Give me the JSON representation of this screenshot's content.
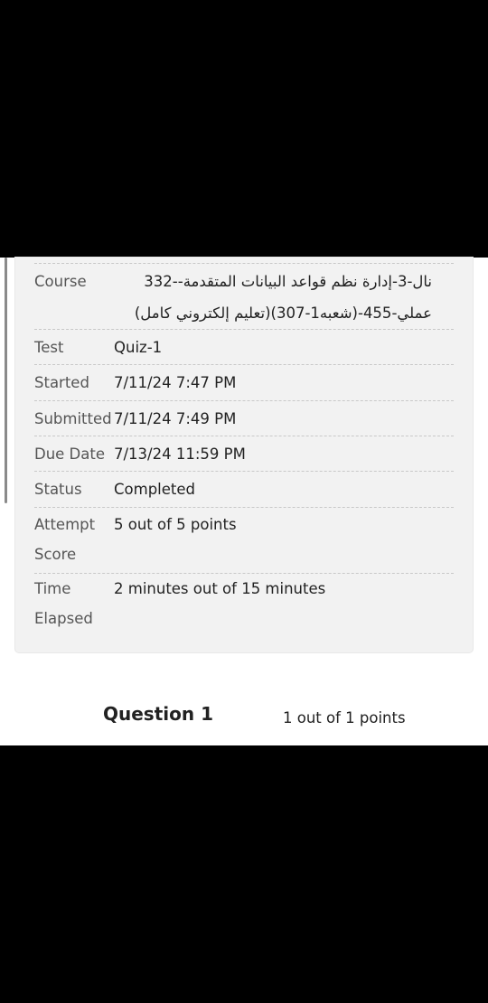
{
  "details": {
    "course": {
      "label": "Course",
      "value_line1": "نال-3-إدارة نظم قواعد البيانات المتقدمة--332",
      "value_line2": "عملي-455-(شعبه1-307)(تعليم إلكتروني كامل)"
    },
    "test": {
      "label": "Test",
      "value": "Quiz-1"
    },
    "started": {
      "label": "Started",
      "value": "7/11/24 7:47 PM"
    },
    "submitted": {
      "label": "Submitted",
      "value": "7/11/24 7:49 PM"
    },
    "due_date": {
      "label": "Due Date",
      "value": "7/13/24 11:59 PM"
    },
    "status": {
      "label": "Status",
      "value": "Completed"
    },
    "attempt_score": {
      "label_line1": "Attempt",
      "label_line2": "Score",
      "value": "5 out of 5 points"
    },
    "time_elapsed": {
      "label_line1": "Time",
      "label_line2": "Elapsed",
      "value": "2 minutes out of 15 minutes"
    }
  },
  "question": {
    "title": "Question 1",
    "points": "1 out of 1 points"
  }
}
